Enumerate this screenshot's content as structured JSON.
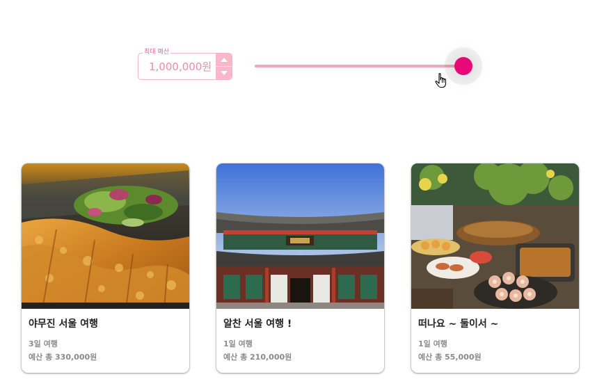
{
  "budget": {
    "label": "최대 예산",
    "value": "1,000,000원",
    "slider_fraction": 0.96,
    "accent_color": "#e8087a"
  },
  "trips": [
    {
      "title": "야무진 서울 여행",
      "days": "3일 여행",
      "budget": "예산 총 330,000원",
      "image": "fried-pork-cutlet-photo"
    },
    {
      "title": "알찬 서울 여행 !",
      "days": "1일 여행",
      "budget": "예산 총 210,000원",
      "image": "palace-gate-photo"
    },
    {
      "title": "떠나요 ~ 둘이서 ~",
      "days": "1일 여행",
      "budget": "예산 총 55,000원",
      "image": "buffet-table-photo"
    }
  ]
}
